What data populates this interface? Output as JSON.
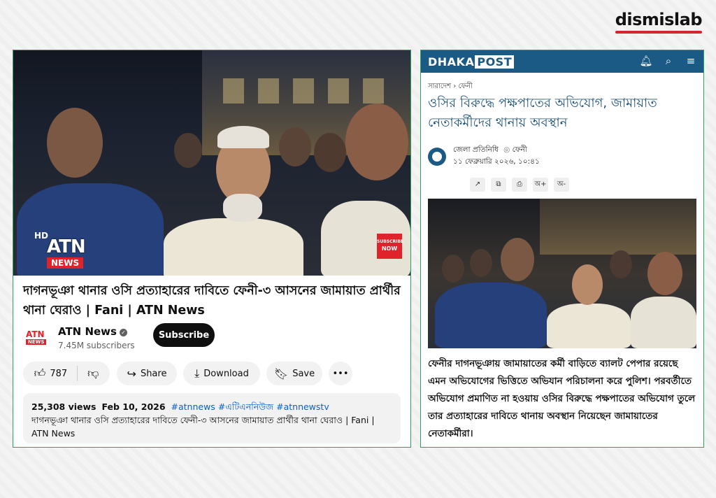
{
  "brand": {
    "name": "dismislab"
  },
  "youtube": {
    "video_overlay": {
      "hd": "HD",
      "logo_top": "ATN",
      "logo_bottom": "NEWS",
      "subscribe_badge_1": "SUBSCRIBE",
      "subscribe_badge_2": "NOW"
    },
    "title": "দাগনভূঞা থানার ওসি প্রত্যাহারের দাবিতে ফেনী-৩ আসনের জামায়াত প্রার্থীর থানা ঘেরাও | Fani | ATN News",
    "channel": {
      "name": "ATN News",
      "subscribers": "7.45M subscribers",
      "subscribe_label": "Subscribe",
      "avatar_top": "ATN",
      "avatar_bottom": "NEWS"
    },
    "actions": {
      "likes": "787",
      "share": "Share",
      "download": "Download",
      "save": "Save",
      "more": "•••"
    },
    "description": {
      "views": "25,308 views",
      "date": "Feb 10, 2026",
      "tags": [
        "#atnnews",
        "#এটিএননিউজ",
        "#atnnewstv"
      ],
      "text": "দাগনভূঞা থানার ওসি প্রত্যাহারের দাবিতে ফেনী-৩ আসনের জামায়াত প্রার্থীর থানা ঘেরাও | Fani | ATN News"
    }
  },
  "dhakapost": {
    "logo_left": "DHAKA",
    "logo_right": "POST",
    "icons": [
      "bell-icon",
      "search-icon",
      "menu-icon"
    ],
    "breadcrumb": [
      "সারাদেশ",
      "ফেনী"
    ],
    "breadcrumb_sep": "›",
    "title": "ওসির বিরুদ্ধে পক্ষপাতের অভিযোগ, জামায়াত নেতাকর্মীদের থানায় অবস্থান",
    "author": "জেলা প্রতিনিধি",
    "location": "ফেনী",
    "datetime": "১১ ফেব্রুয়ারি ২০২৬, ১০:৪১",
    "tools": [
      "↗",
      "⧉",
      "⎙",
      "অ+",
      "অ-"
    ],
    "body": "ফেনীর দাগনভূঞায় জামায়াতের কর্মী বাড়িতে ব্যালট পেপার রয়েছে এমন অভিযোগের ভিত্তিতে অভিযান পরিচালনা করে পুলিশ। পরবর্তীতে অভিযোগ প্রমাণিত না হওয়ায় ওসির বিরুদ্ধে পক্ষপাতের অভিযোগ তুলে তার প্রত্যাহারের দাবিতে থানায় অবস্থান নিয়েছেন জামায়াতের নেতাকর্মীরা।"
  },
  "colors": {
    "dhakapost_blue": "#1c5a86",
    "dismislab_red": "#d7262b",
    "atn_red": "#e0222a",
    "frame_green": "#27a35a"
  }
}
